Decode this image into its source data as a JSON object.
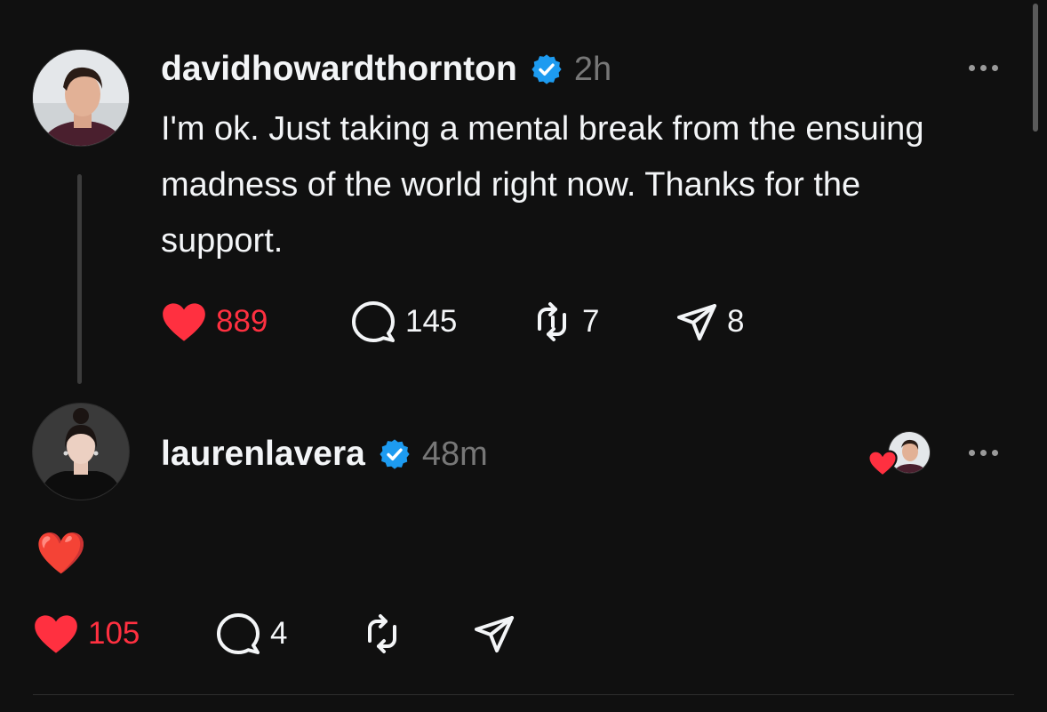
{
  "post": {
    "username": "davidhowardthornton",
    "time": "2h",
    "text": "I'm ok. Just taking a mental break from the ensuing madness of the world right now. Thanks for the support.",
    "likes": "889",
    "replies": "145",
    "reposts": "7",
    "shares": "8"
  },
  "reply": {
    "username": "laurenlavera",
    "time": "48m",
    "text": "❤️",
    "likes": "105",
    "replies": "4"
  },
  "colors": {
    "background": "#101010",
    "liked": "#ff3040",
    "verified": "#1d9bf0",
    "muted": "#777777"
  },
  "icons": [
    "heart-icon",
    "comment-icon",
    "repost-icon",
    "share-icon",
    "verified-badge-icon",
    "more-options-icon"
  ]
}
